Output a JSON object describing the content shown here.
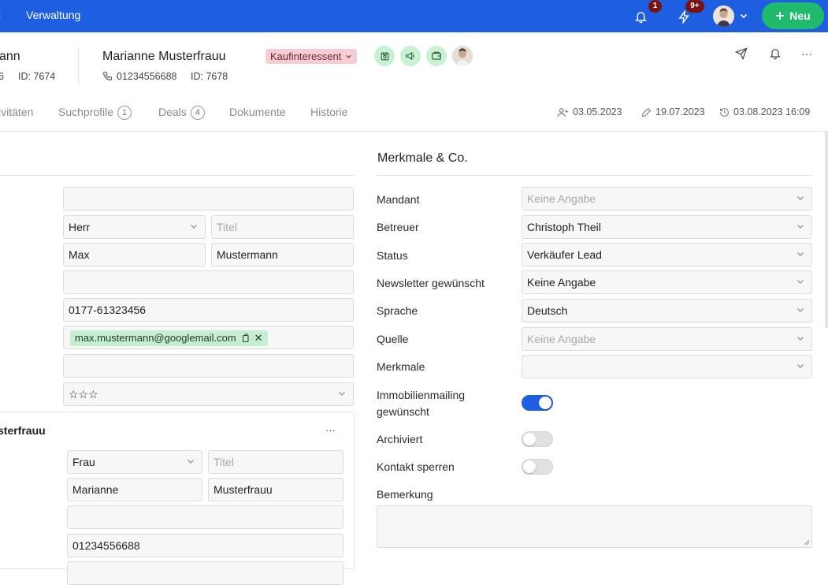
{
  "topbar": {
    "nav_edge": "t",
    "nav_label": "Verwaltung",
    "notifications_count": "1",
    "activity_count": "9+",
    "new_button_label": "Neu",
    "accent": "#1d5fe0",
    "new_color": "#1fba6c"
  },
  "header": {
    "prev_contact_name": "ann",
    "prev_contact_phone_tail": "6",
    "prev_contact_id": "ID: 7674",
    "contact_name": "Marianne Musterfrauu",
    "contact_phone": "01234556688",
    "contact_id": "ID: 7678",
    "status": "Kaufinteressent"
  },
  "tabs": [
    {
      "label": "ivitäten"
    },
    {
      "label": "Suchprofile",
      "count": "1"
    },
    {
      "label": "Deals",
      "count": "4"
    },
    {
      "label": "Dokumente"
    },
    {
      "label": "Historie"
    }
  ],
  "meta": {
    "created": "03.05.2023",
    "edited": "19.07.2023",
    "last_activity": "03.08.2023 16:09"
  },
  "left_form": {
    "salutation": "Herr",
    "title_placeholder": "Titel",
    "first_name": "Max",
    "last_name": "Mustermann",
    "phone": "0177-61323456",
    "email": "max.mustermann@googlemail.com",
    "rating": "☆☆☆"
  },
  "contact_card": {
    "name": "sterfrauu",
    "more": "···",
    "salutation": "Frau",
    "title_placeholder": "Titel",
    "first_name": "Marianne",
    "last_name": "Musterfrauu",
    "phone": "01234556688"
  },
  "features": {
    "title": "Merkmale & Co.",
    "rows": [
      {
        "label": "Mandant",
        "value": "Keine Angabe",
        "placeholder": true
      },
      {
        "label": "Betreuer",
        "value": "Christoph Theil",
        "placeholder": false
      },
      {
        "label": "Status",
        "value": "Verkäufer Lead",
        "placeholder": false
      },
      {
        "label": "Newsletter gewünscht",
        "value": "Keine Angabe",
        "placeholder": false
      },
      {
        "label": "Sprache",
        "value": "Deutsch",
        "placeholder": false
      },
      {
        "label": "Quelle",
        "value": "Keine Angabe",
        "placeholder": true
      },
      {
        "label": "Merkmale",
        "value": "",
        "placeholder": false
      }
    ],
    "immo_label_1": "Immobilienmailing",
    "immo_label_2": "gewünscht",
    "immo_on": true,
    "archived_label": "Archiviert",
    "archived_on": false,
    "block_label": "Kontakt sperren",
    "block_on": false,
    "remark_label": "Bemerkung"
  }
}
